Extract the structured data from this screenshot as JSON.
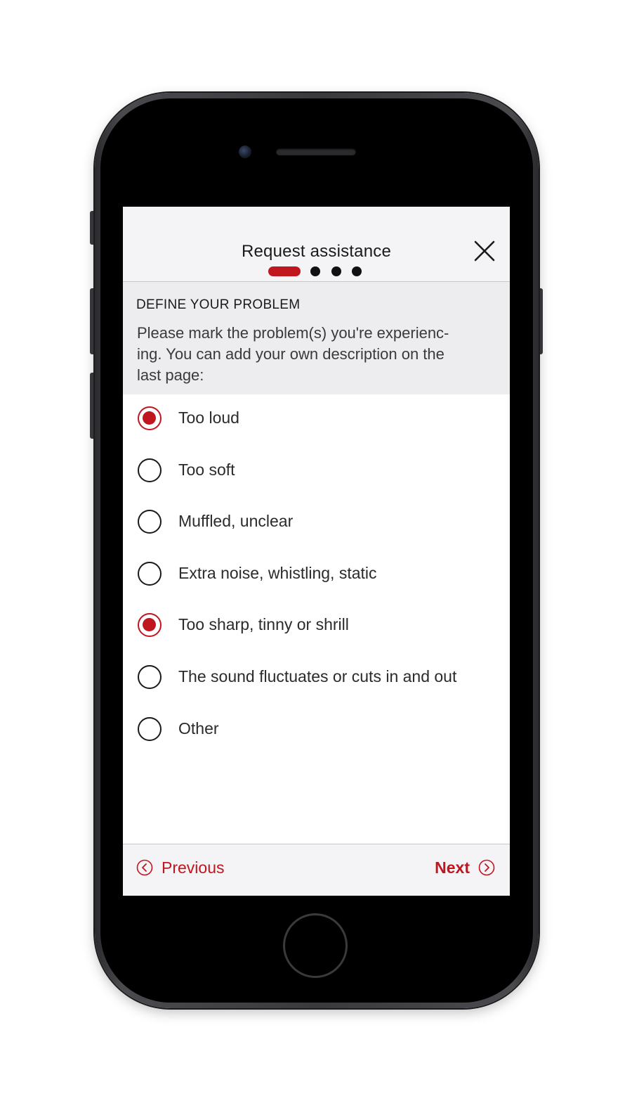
{
  "header": {
    "title": "Request assistance",
    "close_icon": "close-icon",
    "steps_total": 4,
    "step_current": 1
  },
  "intro": {
    "section_title": "DEFINE YOUR PROBLEM",
    "instructions_lines": [
      "Please mark the problem(s) you're experienc-",
      "ing. You can add your own description on the",
      "last page:"
    ]
  },
  "options": [
    {
      "label": "Too loud",
      "checked": true
    },
    {
      "label": "Too soft",
      "checked": false
    },
    {
      "label": "Muffled, unclear",
      "checked": false
    },
    {
      "label": "Extra noise, whistling, static",
      "checked": false
    },
    {
      "label": "Too sharp, tinny or shrill",
      "checked": true
    },
    {
      "label": "The sound fluctuates or cuts in and out",
      "checked": false
    },
    {
      "label": "Other",
      "checked": false
    }
  ],
  "footer": {
    "previous_label": "Previous",
    "next_label": "Next",
    "previous_icon": "chevron-left-circle-icon",
    "next_icon": "chevron-right-circle-icon"
  },
  "colors": {
    "accent": "#c0161f",
    "header_bg": "#f4f4f6",
    "intro_bg": "#ededf0"
  }
}
